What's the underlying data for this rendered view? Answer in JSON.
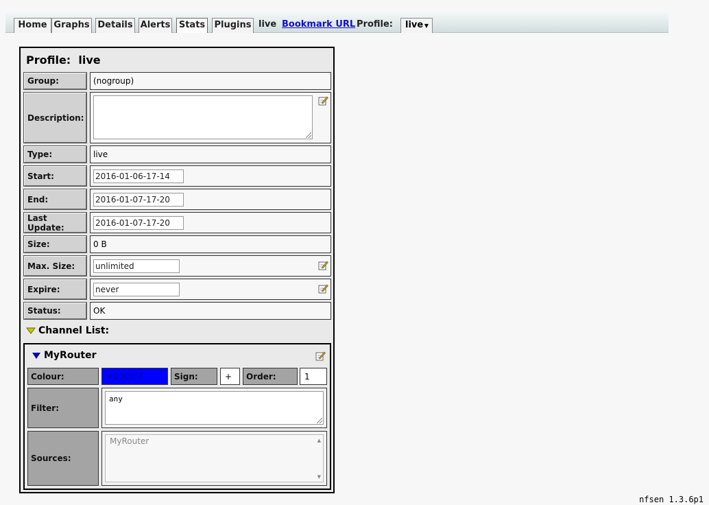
{
  "nav": {
    "tabs": [
      "Home",
      "Graphs",
      "Details",
      "Alerts",
      "Stats",
      "Plugins"
    ],
    "active_tab": "Stats",
    "current_profile": "live",
    "bookmark_label": "Bookmark URL",
    "profile_label": "Profile:",
    "profile_select": "live"
  },
  "profile": {
    "title_label": "Profile:",
    "title_value": "live",
    "group_label": "Group:",
    "group_value": "(nogroup)",
    "description_label": "Description:",
    "description_value": "",
    "type_label": "Type:",
    "type_value": "live",
    "start_label": "Start:",
    "start_value": "2016-01-06-17-14",
    "end_label": "End:",
    "end_value": "2016-01-07-17-20",
    "last_update_label": "Last Update:",
    "last_update_value": "2016-01-07-17-20",
    "size_label": "Size:",
    "size_value": "0 B",
    "max_size_label": "Max. Size:",
    "max_size_value": "unlimited",
    "expire_label": "Expire:",
    "expire_value": "never",
    "status_label": "Status:",
    "status_value": "OK"
  },
  "channel_list": {
    "label": "Channel List:",
    "channel": {
      "name": "MyRouter",
      "colour_label": "Colour:",
      "colour_value": "#0000FF",
      "sign_label": "Sign:",
      "sign_value": "+",
      "order_label": "Order:",
      "order_value": "1",
      "filter_label": "Filter:",
      "filter_value": "any",
      "sources_label": "Sources:",
      "sources_value": "MyRouter"
    }
  },
  "footer": {
    "version": "nfsen 1.3.6p1"
  },
  "colors": {
    "channel_colour": "#0000FF",
    "link": "#1111CC",
    "triangle_yellow": "#C8C800"
  },
  "icons": [
    "edit-icon",
    "triangle-down-icon",
    "chevron-down-icon",
    "resize-grip-icon"
  ]
}
